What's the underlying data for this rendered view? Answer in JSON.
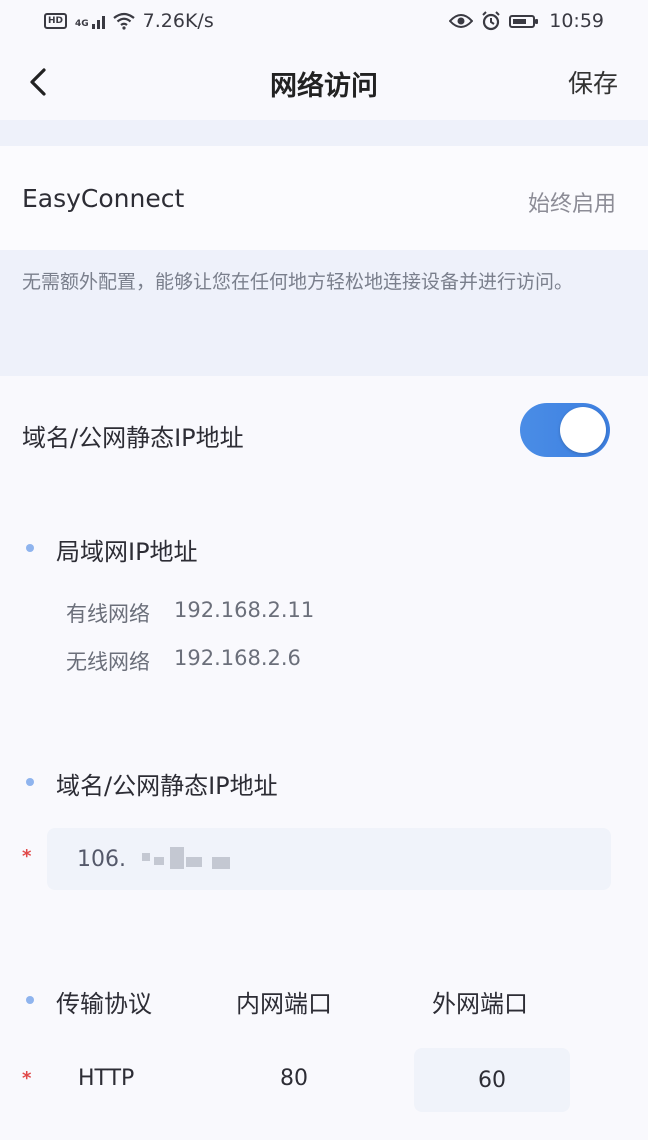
{
  "status_bar": {
    "network_badge": "HD",
    "net_type": "4G",
    "speed": "7.26K/s",
    "time": "10:59"
  },
  "header": {
    "title": "网络访问",
    "save_label": "保存"
  },
  "easyconnect": {
    "label": "EasyConnect",
    "value": "始终启用",
    "description": "无需额外配置，能够让您在任何地方轻松地连接设备并进行访问。"
  },
  "domain_toggle": {
    "label": "域名/公网静态IP地址",
    "enabled": true
  },
  "lan": {
    "title": "局域网IP地址",
    "wired_label": "有线网络",
    "wired_ip": "192.168.2.11",
    "wireless_label": "无线网络",
    "wireless_ip": "192.168.2.6"
  },
  "public_ip": {
    "title": "域名/公网静态IP地址",
    "required_mark": "*",
    "value": "106."
  },
  "protocol": {
    "title": "传输协议",
    "internal_port_header": "内网端口",
    "external_port_header": "外网端口",
    "required_mark": "*",
    "protocol_value": "HTTP",
    "internal_port": "80",
    "external_port": "60"
  },
  "colors": {
    "accent": "#3d7fe0",
    "band": "#eef1fa",
    "required": "#e04848"
  }
}
